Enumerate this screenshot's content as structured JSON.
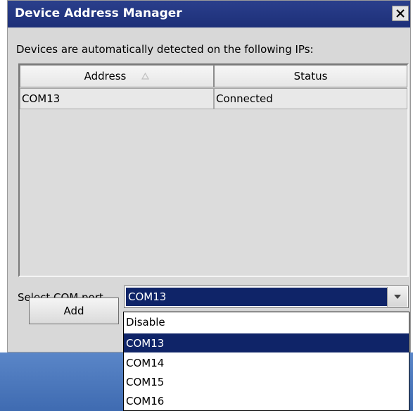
{
  "window": {
    "title": "Device Address Manager",
    "close_glyph": "X"
  },
  "intro_text": "Devices are automatically detected on the following IPs:",
  "table": {
    "columns": [
      "Address",
      "Status"
    ],
    "sort_column": "Address",
    "sort_icon": "sort-ascending-icon",
    "rows": [
      {
        "address": "COM13",
        "status": "Connected"
      }
    ]
  },
  "com_port": {
    "label": "Select COM port",
    "selected": "COM13",
    "options": [
      "Disable",
      "COM13",
      "COM14",
      "COM15",
      "COM16"
    ],
    "expanded": true
  },
  "buttons": {
    "add_label": "Add"
  },
  "colors": {
    "title_bar": "#1d2f78",
    "selection": "#0f2468",
    "dialog_bg": "#d8d8d8",
    "desktop": "#4a76bd"
  }
}
